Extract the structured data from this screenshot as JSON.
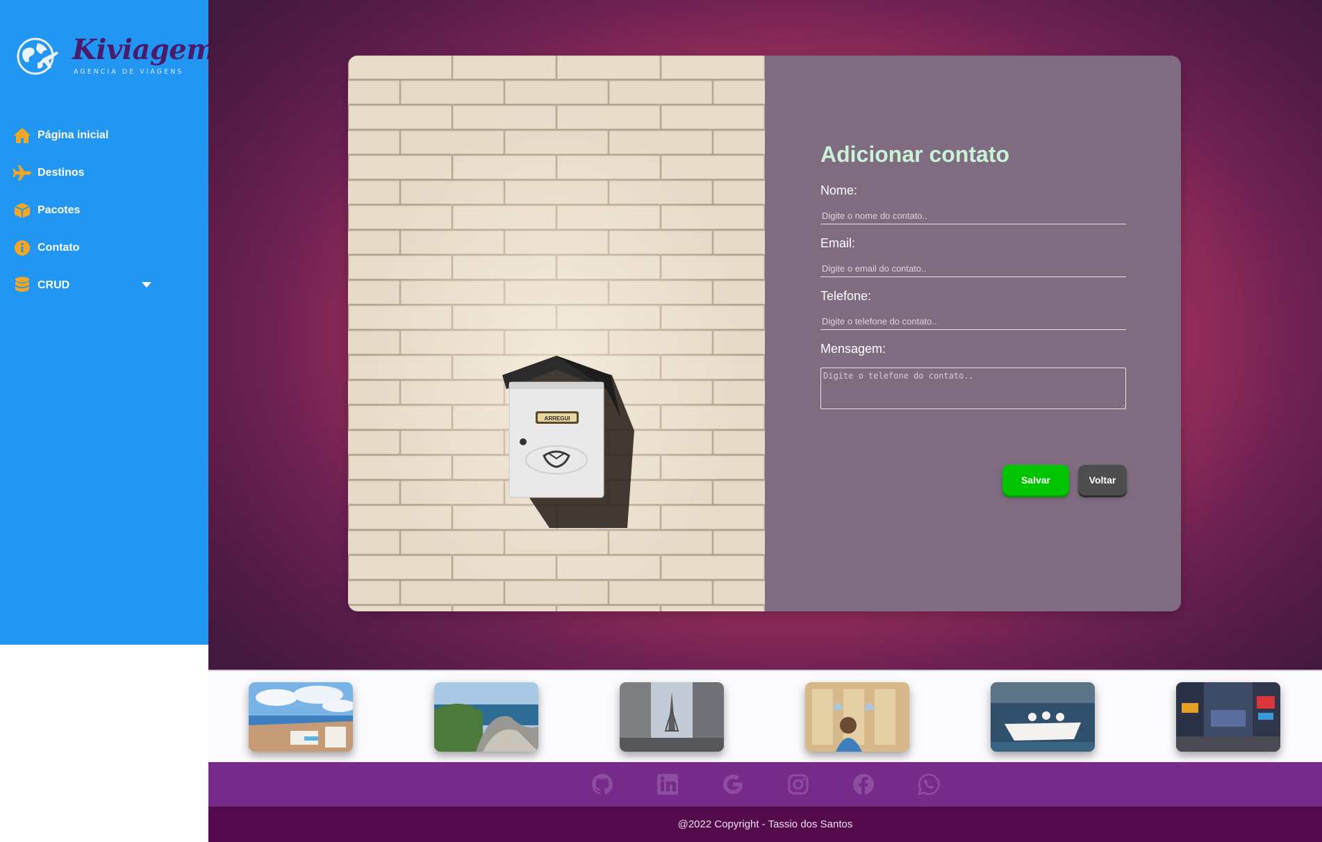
{
  "brand": {
    "name": "Kiviagem",
    "tagline": "AGENCIA DE VIAGENS"
  },
  "sidebar": {
    "items": [
      {
        "label": "Página inicial",
        "icon": "home-icon"
      },
      {
        "label": "Destinos",
        "icon": "plane-icon"
      },
      {
        "label": "Pacotes",
        "icon": "box-icon"
      },
      {
        "label": "Contato",
        "icon": "info-icon"
      },
      {
        "label": "CRUD",
        "icon": "database-icon",
        "has_dropdown": true
      }
    ]
  },
  "mailbox_sign": "ARREGUI",
  "form": {
    "title": "Adicionar contato",
    "name_label": "Nome:",
    "name_placeholder": "Digite o nome do contato..",
    "email_label": "Email:",
    "email_placeholder": "Digite o email do contato..",
    "phone_label": "Telefone:",
    "phone_placeholder": "Digite o telefone do contato..",
    "message_label": "Mensagem:",
    "message_placeholder": "Digite o telefone do contato..",
    "save_label": "Salvar",
    "back_label": "Voltar"
  },
  "gallery": [
    {
      "name": "coastal-town-photo"
    },
    {
      "name": "green-coast-photo"
    },
    {
      "name": "paris-street-photo"
    },
    {
      "name": "ancient-ruins-photo"
    },
    {
      "name": "boat-river-photo"
    },
    {
      "name": "city-square-photo"
    }
  ],
  "social": [
    "github-icon",
    "linkedin-icon",
    "google-icon",
    "instagram-icon",
    "facebook-icon",
    "whatsapp-icon"
  ],
  "footer": {
    "copyright": "@2022 Copyright - Tassio dos Santos"
  },
  "colors": {
    "sidebar": "#2196f3",
    "icon_accent": "#f5a623",
    "form_panel": "#7f6c80",
    "title": "#c9f2d6",
    "save_button": "#00c400",
    "back_button": "#4e4e4e",
    "social_bar": "#762b8a",
    "copyright_bar": "#550a4e"
  }
}
